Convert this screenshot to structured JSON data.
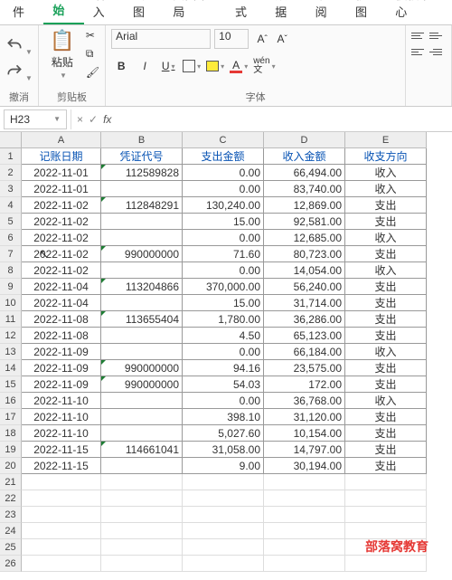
{
  "menu": {
    "file": "文件",
    "start": "开始",
    "insert": "插入",
    "draw": "绘图",
    "layout": "页面布局",
    "formula": "公式",
    "data": "数据",
    "review": "审阅",
    "view": "视图",
    "template": "模板中心"
  },
  "ribbon": {
    "undo_label": "撤消",
    "clipboard_label": "剪贴板",
    "paste_label": "粘贴",
    "font_label": "字体",
    "font_name": "Arial",
    "font_size": "10",
    "bold": "B",
    "italic": "I",
    "underline": "U",
    "font_color_a": "A",
    "wen": "wén",
    "wen2": "文"
  },
  "namebox": "H23",
  "fx": "fx",
  "cols": {
    "A": "A",
    "B": "B",
    "C": "C",
    "D": "D",
    "E": "E"
  },
  "headers": {
    "A": "记账日期",
    "B": "凭证代号",
    "C": "支出金额",
    "D": "收入金额",
    "E": "收支方向"
  },
  "chart_data": {
    "type": "table",
    "columns": [
      "记账日期",
      "凭证代号",
      "支出金额",
      "收入金额",
      "收支方向"
    ],
    "rows": [
      [
        "2022-11-01",
        "112589828",
        "0.00",
        "66,494.00",
        "收入"
      ],
      [
        "2022-11-01",
        "",
        "0.00",
        "83,740.00",
        "收入"
      ],
      [
        "2022-11-02",
        "112848291",
        "130,240.00",
        "12,869.00",
        "支出"
      ],
      [
        "2022-11-02",
        "",
        "15.00",
        "92,581.00",
        "支出"
      ],
      [
        "2022-11-02",
        "",
        "0.00",
        "12,685.00",
        "收入"
      ],
      [
        "2022-11-02",
        "990000000",
        "71.60",
        "80,723.00",
        "支出"
      ],
      [
        "2022-11-02",
        "",
        "0.00",
        "14,054.00",
        "收入"
      ],
      [
        "2022-11-04",
        "113204866",
        "370,000.00",
        "56,240.00",
        "支出"
      ],
      [
        "2022-11-04",
        "",
        "15.00",
        "31,714.00",
        "支出"
      ],
      [
        "2022-11-08",
        "113655404",
        "1,780.00",
        "36,286.00",
        "支出"
      ],
      [
        "2022-11-08",
        "",
        "4.50",
        "65,123.00",
        "支出"
      ],
      [
        "2022-11-09",
        "",
        "0.00",
        "66,184.00",
        "收入"
      ],
      [
        "2022-11-09",
        "990000000",
        "94.16",
        "23,575.00",
        "支出"
      ],
      [
        "2022-11-09",
        "990000000",
        "54.03",
        "172.00",
        "支出"
      ],
      [
        "2022-11-10",
        "",
        "0.00",
        "36,768.00",
        "收入"
      ],
      [
        "2022-11-10",
        "",
        "398.10",
        "31,120.00",
        "支出"
      ],
      [
        "2022-11-10",
        "",
        "5,027.60",
        "10,154.00",
        "支出"
      ],
      [
        "2022-11-15",
        "114661041",
        "31,058.00",
        "14,797.00",
        "支出"
      ],
      [
        "2022-11-15",
        "",
        "9.00",
        "30,194.00",
        "支出"
      ]
    ]
  },
  "watermark": "部落窝教育"
}
